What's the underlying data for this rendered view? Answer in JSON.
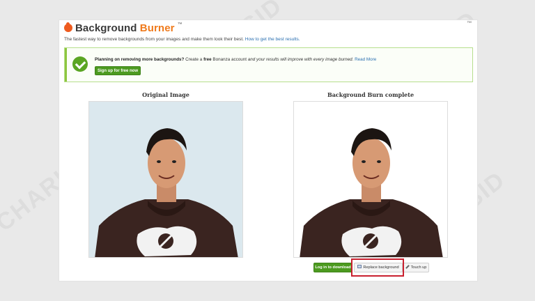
{
  "app": {
    "name_part1": "Background",
    "name_part2": "Burner",
    "tm": "™",
    "corner_mark": "™"
  },
  "tagline": {
    "text": "The fastest way to remove backgrounds from your images and make them look their best.",
    "link": "How to get the best results."
  },
  "promo": {
    "bold_lead": "Planning on removing more backgrounds?",
    "text_mid": " Create a ",
    "bold_free": "free",
    "text_after": " Bonanza account ",
    "italic_text": "and your results will improve with every image burned.",
    "read_more": "Read More",
    "signup_label": "Sign up for free now"
  },
  "columns": {
    "original_title": "Original Image",
    "result_title": "Background Burn complete"
  },
  "actions": {
    "login_label": "Log in to download",
    "replace_label": "Replace background",
    "touch_label": "Touch up"
  },
  "watermark": "CHARISID",
  "colors": {
    "accent_green": "#4c9a20",
    "brand_orange": "#ef7a1c",
    "highlight_red": "#c9202f",
    "link_blue": "#2a6fb0"
  }
}
